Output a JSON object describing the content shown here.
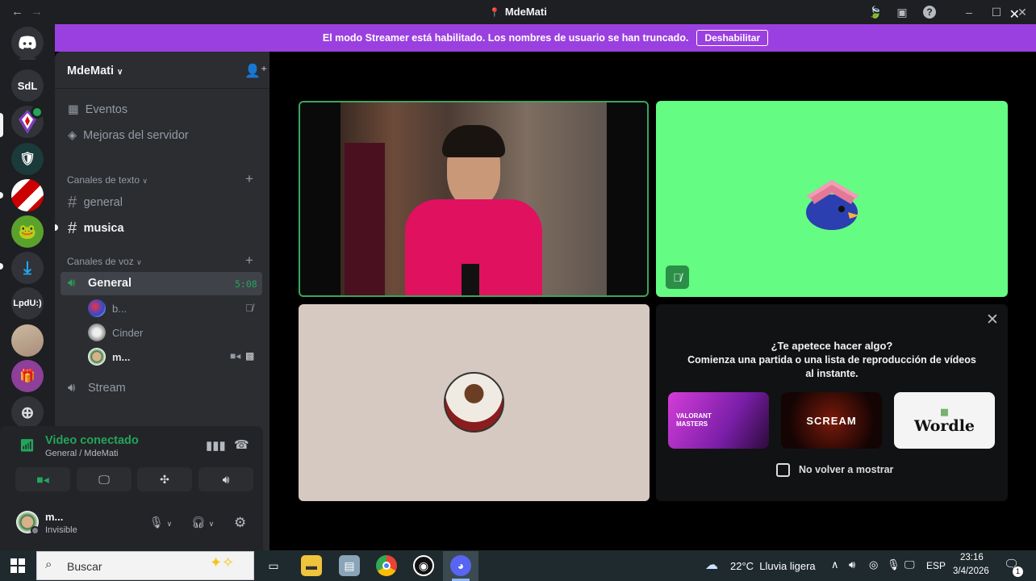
{
  "window": {
    "title": "MdeMati"
  },
  "rail": {
    "servers": [
      {
        "label": "SdL"
      },
      {
        "label": "LpdU:)"
      }
    ]
  },
  "banner": {
    "text": "El modo Streamer está habilitado. Los nombres de usuario se han truncado.",
    "button": "Deshabilitar"
  },
  "sidebar": {
    "server_name": "MdeMati",
    "items": [
      {
        "label": "Eventos"
      },
      {
        "label": "Mejoras del servidor"
      }
    ],
    "text_category": "Canales de texto",
    "text_channels": [
      {
        "name": "general"
      },
      {
        "name": "musica"
      }
    ],
    "voice_category": "Canales de voz",
    "voice_channel": {
      "name": "General",
      "timer": "5:08"
    },
    "voice_users": [
      {
        "name": "b..."
      },
      {
        "name": "Cinder"
      },
      {
        "name": "m..."
      }
    ],
    "stage_channel": {
      "name": "Stream"
    }
  },
  "voice_panel": {
    "status": "Video conectado",
    "location": "General / MdeMati"
  },
  "user_panel": {
    "name": "m...",
    "status": "Invisible"
  },
  "activity": {
    "heading": "¿Te apetece hacer algo?",
    "subtext": "Comienza una partida o una lista de reproducción de vídeos al instante.",
    "games": [
      {
        "name": "VALORANT MASTERS"
      },
      {
        "name": "SCREAM"
      },
      {
        "name": "Wordle"
      }
    ],
    "checkbox_label": "No volver a mostrar"
  },
  "taskbar": {
    "search_placeholder": "Buscar",
    "weather": "22°C  Lluvia ligera",
    "language": "ESP",
    "time": "23:16",
    "date": "3/4/2026",
    "notifications": "1"
  },
  "colors": {
    "banner": "#9b40e0",
    "connected": "#23a55a",
    "speaking_border": "#3ba55d",
    "bird_tile": "#64fc82"
  }
}
